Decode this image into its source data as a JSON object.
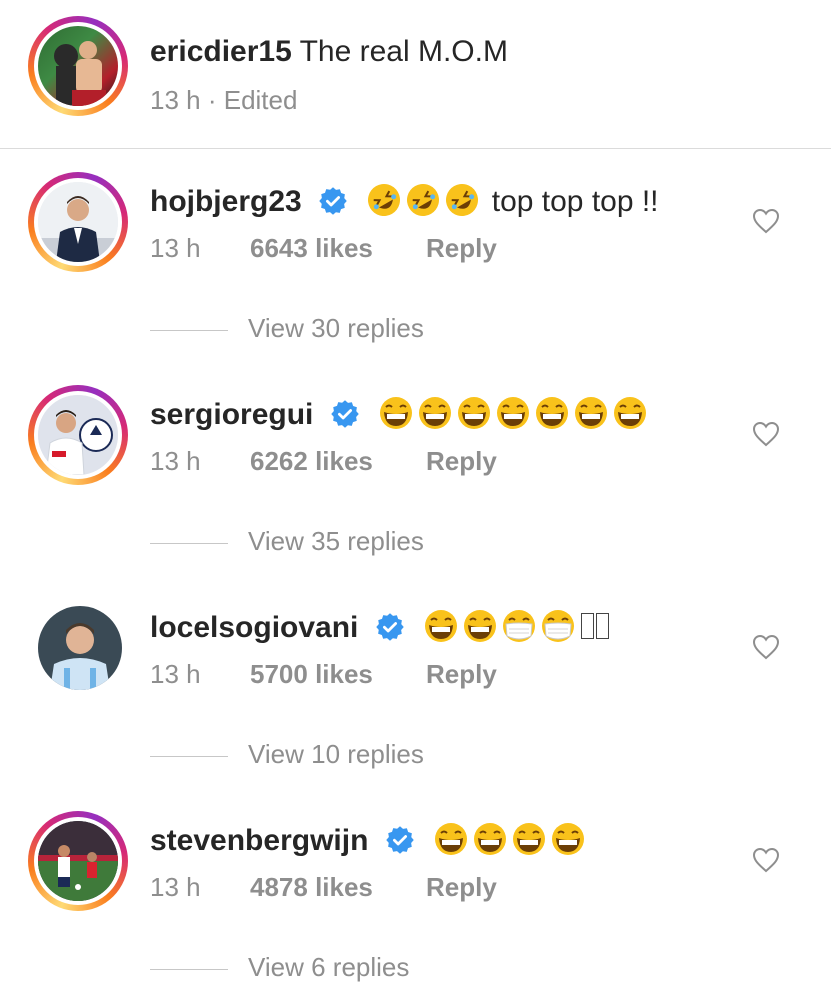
{
  "caption": {
    "username": "ericdier15",
    "text": "The real M.O.M",
    "time": "13 h",
    "edited": "· Edited"
  },
  "comments": [
    {
      "username": "hojbjerg23",
      "verified": true,
      "emojis": [
        "rolling-on-floor-laughing",
        "rolling-on-floor-laughing",
        "rolling-on-floor-laughing"
      ],
      "text": "top top top !!",
      "time": "13 h",
      "likes": "6643 likes",
      "reply": "Reply",
      "view_replies": "View 30 replies"
    },
    {
      "username": "sergioregui",
      "verified": true,
      "emojis": [
        "grinning-squinting",
        "grinning-squinting",
        "grinning-squinting",
        "grinning-squinting",
        "grinning-squinting",
        "grinning-squinting",
        "grinning-squinting"
      ],
      "text": "",
      "time": "13 h",
      "likes": "6262 likes",
      "reply": "Reply",
      "view_replies": "View 35 replies"
    },
    {
      "username": "locelsogiovani",
      "verified": true,
      "emojis": [
        "grinning-squinting",
        "grinning-squinting",
        "face-with-mask",
        "face-with-mask"
      ],
      "text": "",
      "time": "13 h",
      "likes": "5700 likes",
      "reply": "Reply",
      "view_replies": "View 10 replies"
    },
    {
      "username": "stevenbergwijn",
      "verified": true,
      "emojis": [
        "grinning-squinting",
        "grinning-squinting",
        "grinning-squinting",
        "grinning-squinting"
      ],
      "text": "",
      "time": "13 h",
      "likes": "4878 likes",
      "reply": "Reply",
      "view_replies": "View 6 replies"
    }
  ],
  "colors": {
    "text": "#262626",
    "muted": "#8e8e8e",
    "verified_blue": "#3897f0",
    "emoji_yellow": "#f9c21b"
  }
}
